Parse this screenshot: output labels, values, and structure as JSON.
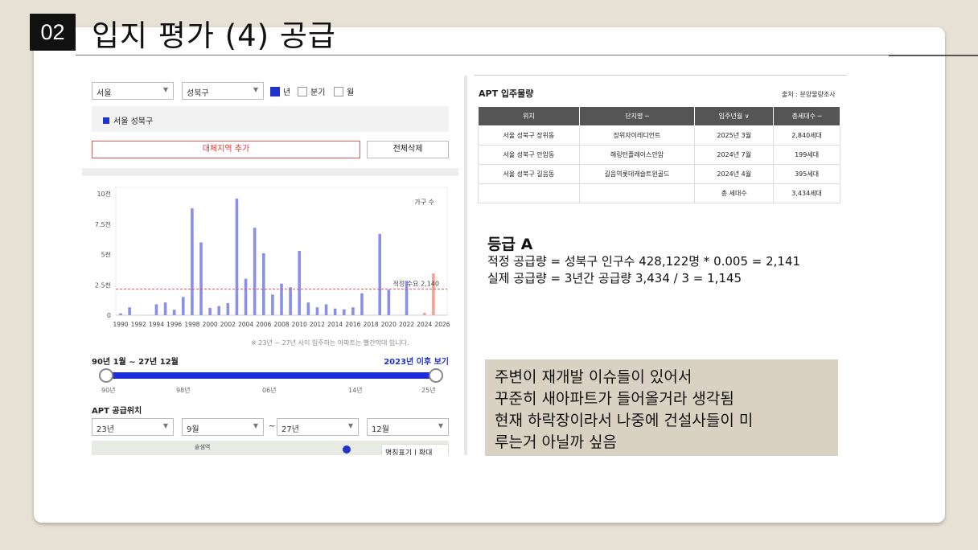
{
  "slide": {
    "number": "02",
    "title": "입지 평가 (4) 공급"
  },
  "filters": {
    "city": "서울",
    "district": "성북구",
    "checks": [
      {
        "label": "년",
        "checked": true
      },
      {
        "label": "분기",
        "checked": false
      },
      {
        "label": "월",
        "checked": false
      }
    ],
    "selected_region": "서울 성북구",
    "add_region_label": "대체지역 추가",
    "delete_all_label": "전체삭제"
  },
  "chart_data": {
    "type": "bar",
    "legend": "가구 수",
    "y_ticks": [
      "10천",
      "7.5천",
      "5천",
      "2.5천",
      "0"
    ],
    "ylim": [
      0,
      10000
    ],
    "x_ticks": [
      "1990",
      "1992",
      "1994",
      "1996",
      "1998",
      "2000",
      "2002",
      "2004",
      "2006",
      "2008",
      "2010",
      "2012",
      "2014",
      "2016",
      "2018",
      "2020",
      "2022",
      "2024",
      "2026"
    ],
    "threshold_label": "적정 수요 2,140",
    "threshold": 2140,
    "note": "※ 23년 ~ 27년 사이 입주하는 아파트는 빨간막대 입니다.",
    "series": [
      {
        "x": [
          1990,
          1991,
          1994,
          1995,
          1996,
          1997,
          1998,
          1999,
          2000,
          2001,
          2002,
          2003,
          2004,
          2005,
          2006,
          2007,
          2008,
          2009,
          2010,
          2011,
          2012,
          2013,
          2014,
          2015,
          2016,
          2017,
          2019,
          2020,
          2022,
          2024,
          2025
        ],
        "values": [
          150,
          650,
          900,
          1050,
          450,
          1500,
          8800,
          6000,
          600,
          750,
          1000,
          9600,
          3000,
          7200,
          5100,
          1700,
          2600,
          2300,
          5300,
          1050,
          650,
          900,
          550,
          480,
          650,
          1800,
          6700,
          2100,
          2840,
          199,
          3434
        ],
        "highlight_from": 2023
      }
    ]
  },
  "period": {
    "label": "90년 1월 ~ 27년 12월",
    "since_link": "2023년 이후 보기",
    "ticks": [
      "90년",
      "98년",
      "06년",
      "14년",
      "25년"
    ]
  },
  "apt_location": {
    "label": "APT 공급위치",
    "from_year": "23년",
    "from_month": "9월",
    "tilde": "~",
    "to_year": "27년",
    "to_month": "12월",
    "map_label": "솔샘역",
    "map_controls": "명칭표기 | 확대"
  },
  "apt_table": {
    "title": "APT 입주물량",
    "source": "출처 : 분양물량조사",
    "headers": [
      "위치",
      "단지명 ─",
      "입주년월 ∨",
      "총세대수 ─"
    ],
    "rows": [
      [
        "서울 성북구 장위동",
        "장위자이레디언트",
        "2025년 3월",
        "2,840세대"
      ],
      [
        "서울 성북구 안암동",
        "해링턴플레이스안암",
        "2024년 7월",
        "199세대"
      ],
      [
        "서울 성북구 길음동",
        "길음역롯데캐슬트윈골드",
        "2024년 4월",
        "395세대"
      ]
    ],
    "total_label": "총 세대수",
    "total_value": "3,434세대"
  },
  "grade": {
    "title": "등급 A",
    "line1": "적정 공급량 = 성북구 인구수 428,122명 * 0.005 = 2,141",
    "line2": "실제 공급량 = 3년간 공급량 3,434 / 3 = 1,145"
  },
  "comment": {
    "line1": "주변이 재개발 이슈들이 있어서",
    "line2": "꾸준히 새아파트가 들어올거라 생각됨",
    "line3": "현재 하락장이라서 나중에 건설사들이 미",
    "line4": "루는거 아닐까 싶음"
  },
  "colors": {
    "bar": "#8890e8",
    "bar_highlight": "#f3a191",
    "threshold": "#e05555",
    "accent": "#2233cc"
  }
}
